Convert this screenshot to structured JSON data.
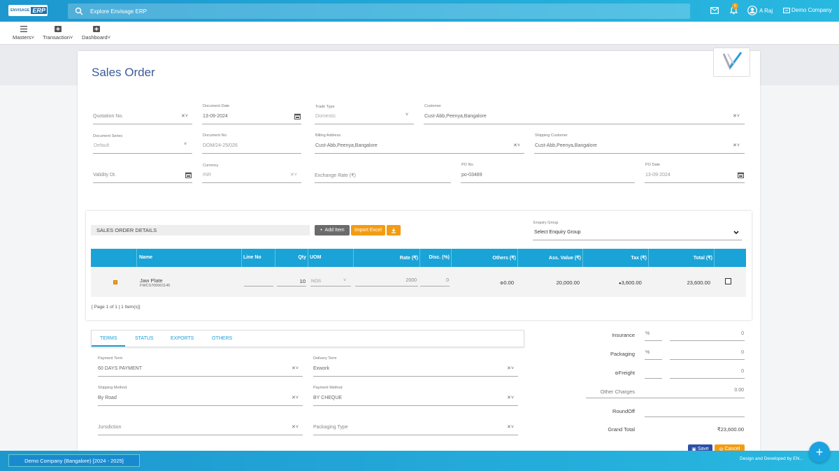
{
  "topbar": {
    "logo_a": "ENVISAGE",
    "logo_b": "ERP",
    "search_placeholder": "Explore Envisage ERP",
    "notif_count": "5",
    "user": "A Raj",
    "company": "Demo Company"
  },
  "menu": {
    "masters": "Masters",
    "transaction": "Transaction",
    "dashboard": "Dashboard"
  },
  "page": {
    "title": "Sales Order"
  },
  "form": {
    "quotation_no": "Quotation No.",
    "doc_date_label": "Document Date",
    "doc_date": "13-09-2024",
    "trade_type_label": "Trade Type",
    "trade_type": "Domestic",
    "customer_label": "Customer",
    "customer": "Cust-Abb,Peenya,Bangalore",
    "doc_series_label": "Document Series",
    "doc_series": "Default",
    "doc_no_label": "Document No.",
    "doc_no": "DOM/24-25/026",
    "billing_label": "Billing Address",
    "billing": "Cust-Abb,Peenya,Bangalore",
    "ship_cust_label": "Shipping Customer",
    "ship_cust": "Cust-Abb,Peenya,Bangalore",
    "validity": "Validity Dt.",
    "currency_label": "Currency",
    "currency": "INR",
    "exchange": "Exchange Rate (₹)",
    "po_no_label": "PO No.",
    "po_no": "po-03489",
    "po_date_label": "PO Date",
    "po_date": "13-09-2024"
  },
  "details": {
    "title": "SALES ORDER DETAILS",
    "add_item": "Add Item",
    "import_excel": "Import Excel",
    "enquiry_label": "Enquiry Group",
    "enquiry_value": "Select Enquiry Group",
    "pager": "[ Page 1 of 1 | 1 Item(s)]"
  },
  "table": {
    "headers": [
      "Name",
      "Line No",
      "Qty",
      "UOM",
      "Rate (₹)",
      "Disc. (%)",
      "Others (₹)",
      "Ass. Value (₹)",
      "Tax (₹)",
      "Total (₹)"
    ],
    "row": {
      "name": "Jaw Plate",
      "code": "FWCS700001145",
      "qty": "10",
      "uom": "NOS",
      "rate": "2000",
      "disc": "0",
      "others": "0.00",
      "ass_value": "20,000.00",
      "tax": "3,600.00",
      "total": "23,600.00"
    }
  },
  "tabs": [
    "TERMS",
    "STATUS",
    "EXPORTS",
    "OTHERS"
  ],
  "terms": {
    "payment_term_label": "Payment Term",
    "payment_term": "60 DAYS PAYMENT",
    "delivery_term_label": "Delivery Term",
    "delivery_term": "Exwork",
    "ship_method_label": "Shipping Method",
    "ship_method": "By Road",
    "pay_method_label": "Payment Method",
    "pay_method": "BY CHEQUE",
    "jurisdiction": "Jursdiction",
    "packaging_type": "Packaging Type"
  },
  "totals": {
    "insurance": "Insurance",
    "insurance_val": "0",
    "pct": "%",
    "packaging": "Packaging",
    "packaging_val": "0",
    "freight": "Freight",
    "freight_val": "0",
    "other_charges": "Other Charges",
    "other_val": "0.00",
    "roundoff": "RoundOff",
    "grand_total": "Grand Total",
    "grand_val": "₹23,600.00"
  },
  "actions": {
    "save": "Save",
    "cancel": "Cancel"
  },
  "footer": {
    "company": "Demo Company (Bangalore) [2024 - 2025]",
    "credit": "Design and Developed by EN..."
  },
  "colors": {
    "primary": "#1aa3d6",
    "orange": "#f39c12",
    "title": "#3b5a9a"
  }
}
